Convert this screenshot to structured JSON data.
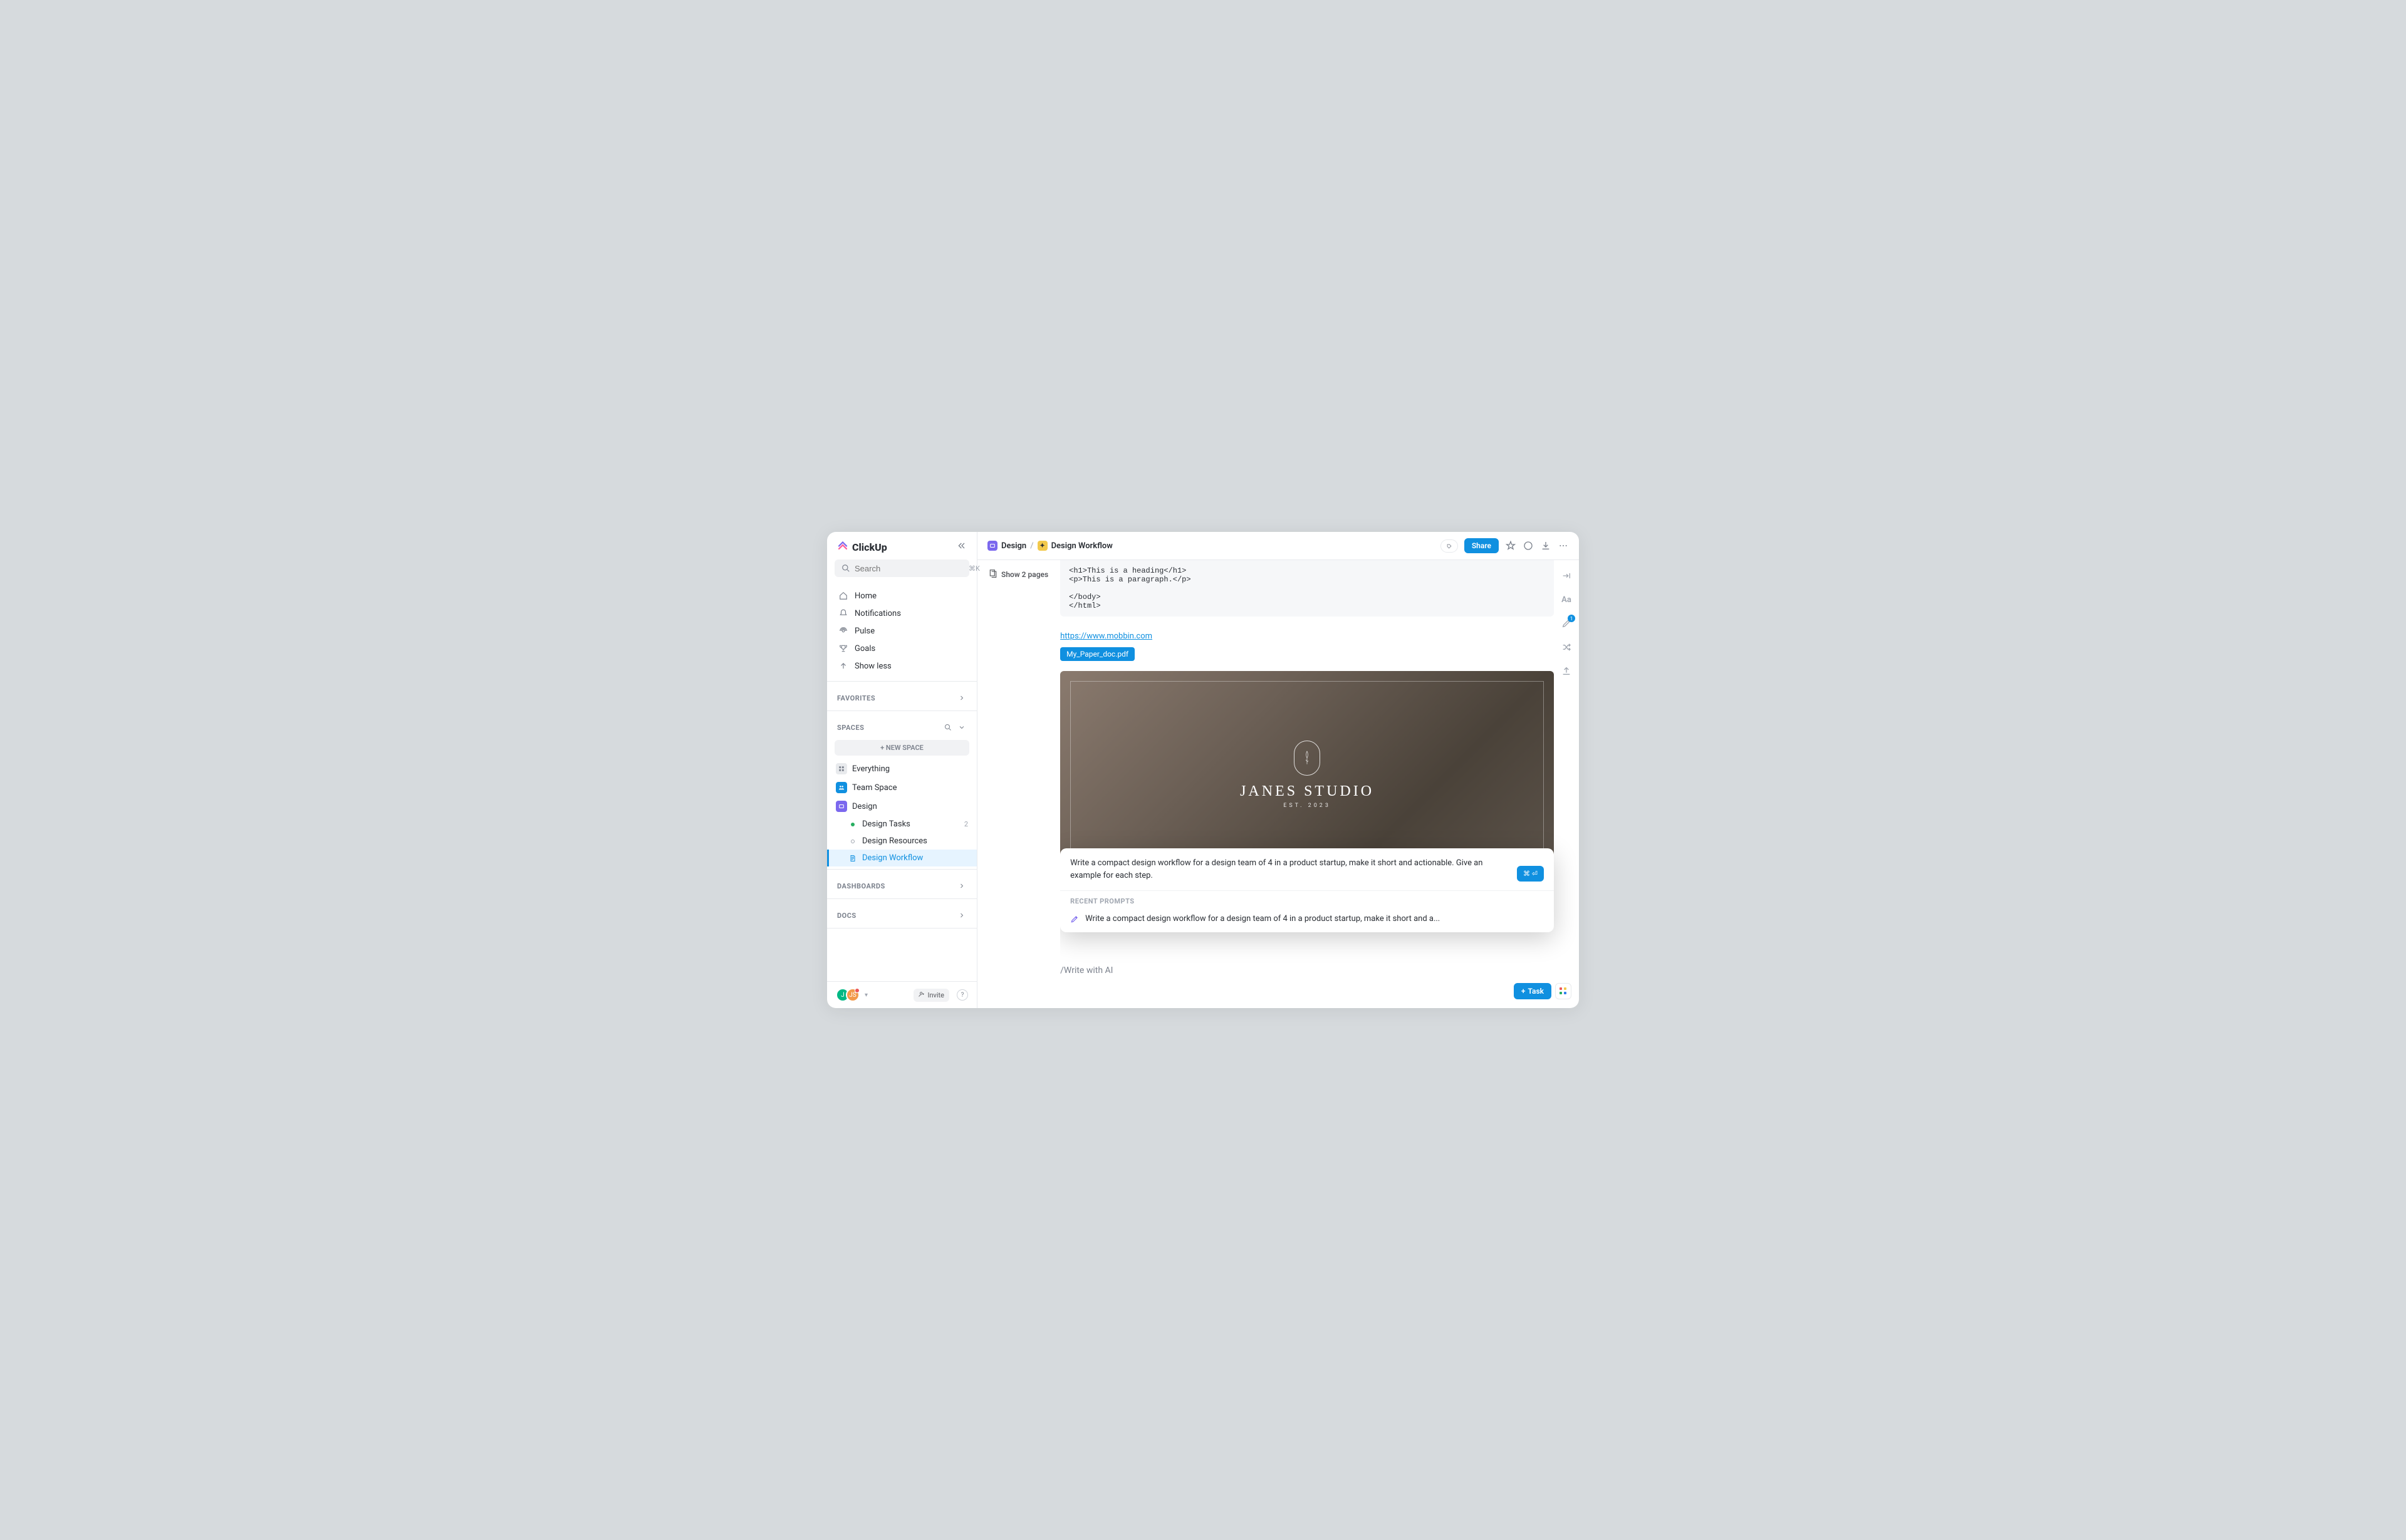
{
  "app": {
    "name": "ClickUp"
  },
  "search": {
    "placeholder": "Search",
    "shortcut": "⌘K"
  },
  "nav": {
    "home": "Home",
    "notifications": "Notifications",
    "pulse": "Pulse",
    "goals": "Goals",
    "showless": "Show less"
  },
  "sections": {
    "favorites": "FAVORITES",
    "spaces": "SPACES",
    "dashboards": "DASHBOARDS",
    "docs": "DOCS"
  },
  "spaces": {
    "new_space": "+ NEW SPACE",
    "everything": "Everything",
    "team": "Team Space",
    "design": "Design",
    "design_tasks": "Design Tasks",
    "design_tasks_count": "2",
    "design_resources": "Design Resources",
    "design_workflow": "Design Workflow"
  },
  "footer": {
    "invite": "Invite"
  },
  "breadcrumb": {
    "design": "Design",
    "workflow": "Design Workflow"
  },
  "topbar": {
    "share": "Share"
  },
  "leftpanel": {
    "show_pages": "Show 2 pages"
  },
  "doc": {
    "code": "<h1>This is a heading</h1>\n<p>This is a paragraph.</p>\n\n</body>\n</html>",
    "link": "https://www.mobbin.com",
    "file": "My_Paper_doc.pdf",
    "hero_title": "JANES STUDIO",
    "hero_sub": "EST. 2023",
    "slash": "/Write with AI"
  },
  "ai": {
    "prompt": "Write a compact design workflow for a design team of 4 in a product startup, make it short and actionable. Give an example for each step.",
    "submit": "⌘ ⏎",
    "recent_header": "RECENT PROMPTS",
    "recent_item": "Write a compact design workflow for a design team of 4 in a product startup, make it short and a..."
  },
  "right_toolbar": {
    "badge": "1"
  },
  "fab": {
    "task": "Task"
  }
}
